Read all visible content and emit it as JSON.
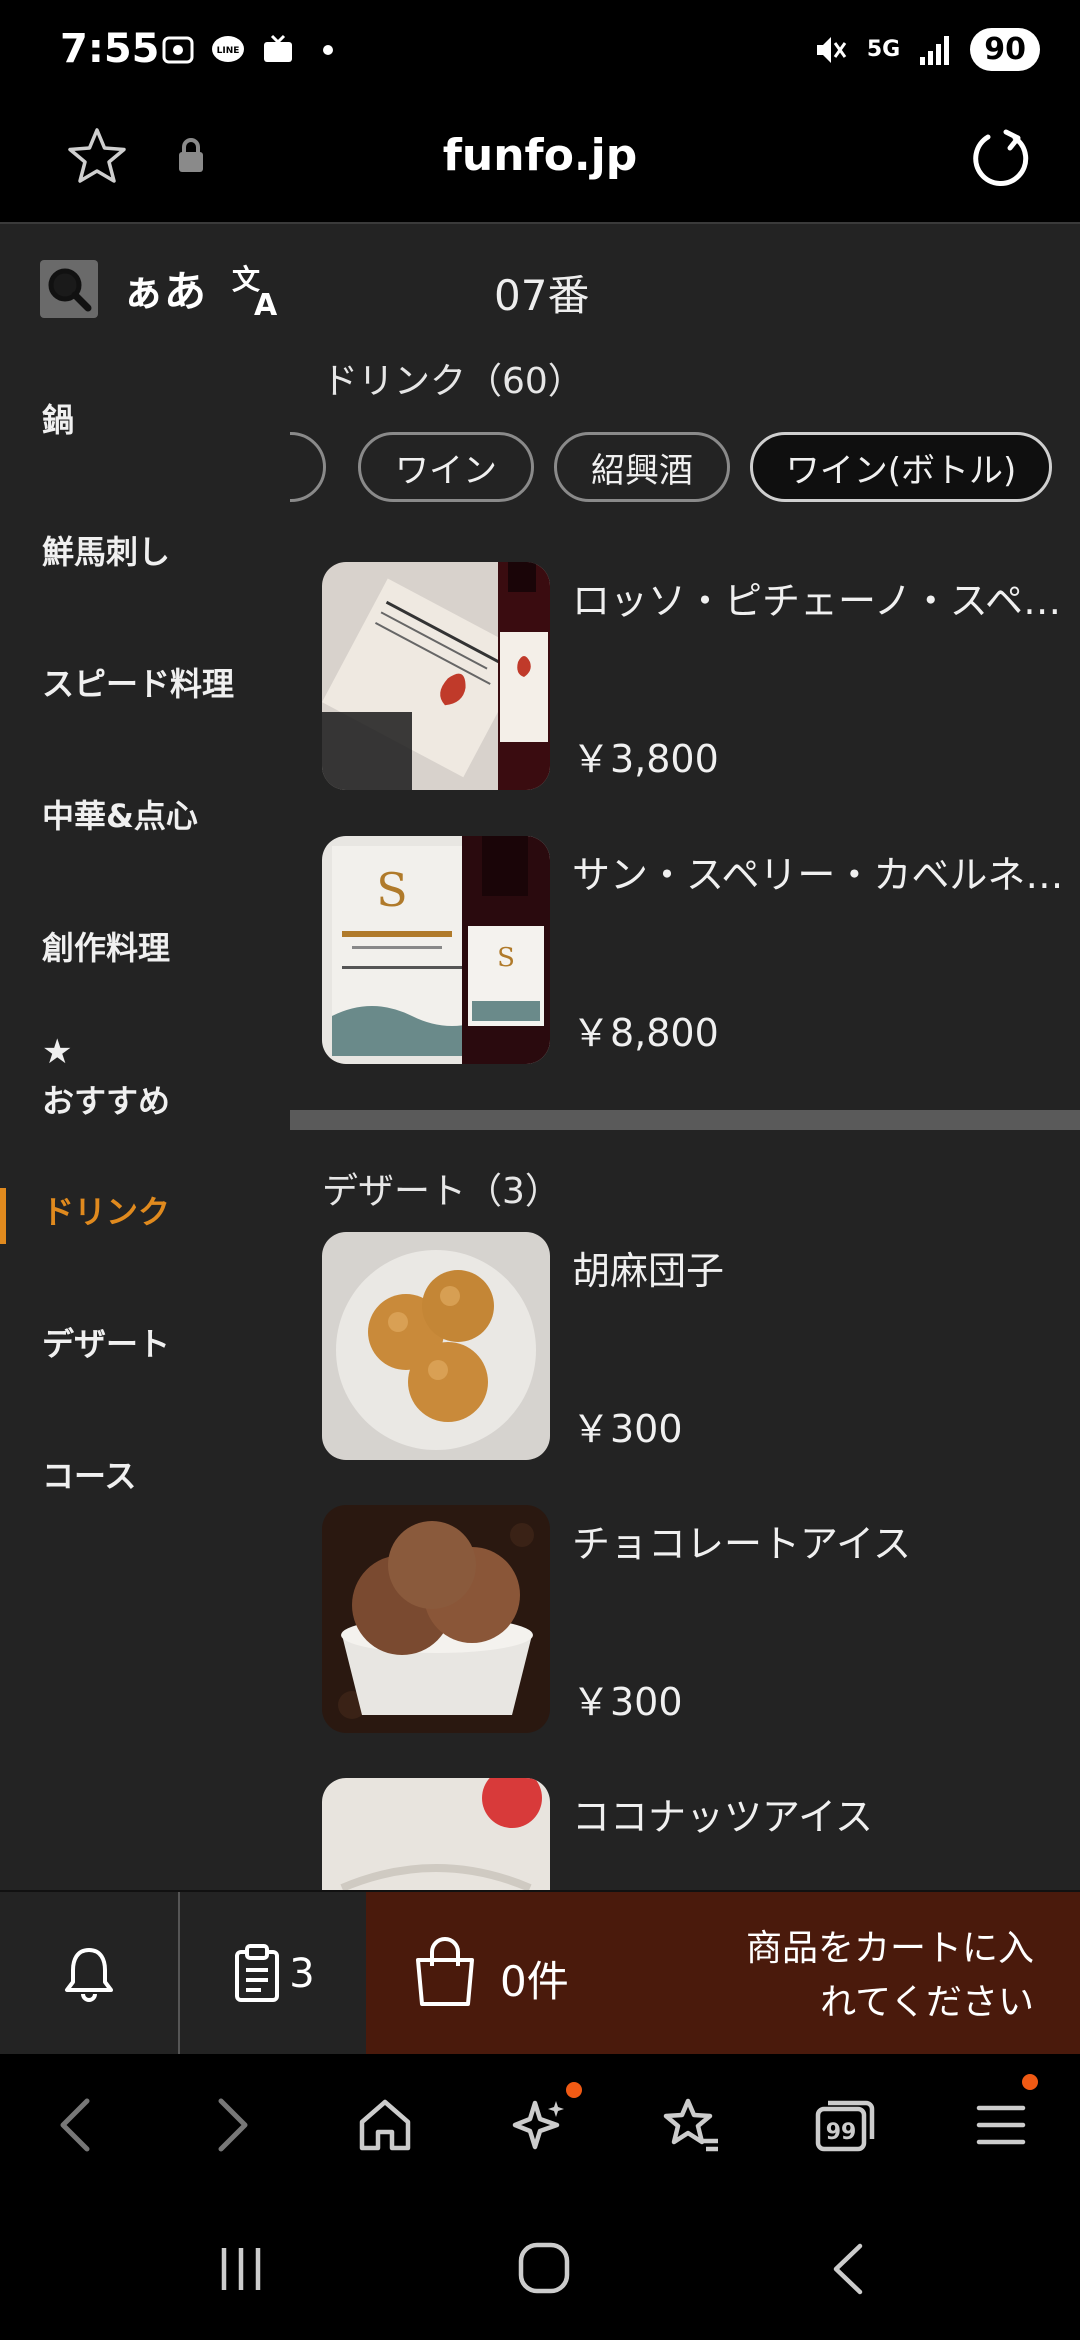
{
  "status": {
    "time": "7:55",
    "network": "5G",
    "battery": "90"
  },
  "browser": {
    "url": "funfo.jp"
  },
  "toolbar": {
    "font_toggle": "ぁあ",
    "table_number": "07番"
  },
  "sidebar": {
    "items": [
      {
        "label": "鍋"
      },
      {
        "label": "鮮馬刺し"
      },
      {
        "label": "スピード料理"
      },
      {
        "label": "中華&点心"
      },
      {
        "label": "創作料理"
      },
      {
        "label": "おすすめ",
        "icon": "star-icon"
      },
      {
        "label": "ドリンク",
        "active": true
      },
      {
        "label": "デザート"
      },
      {
        "label": "コース"
      }
    ]
  },
  "sections": {
    "drink": {
      "title": "ドリンク（60）",
      "chips": [
        "ワイン",
        "紹興酒",
        "ワイン(ボトル)"
      ],
      "active_chip": "ワイン(ボトル)",
      "items": [
        {
          "name": "ロッソ・ピチェーノ・スペリオーレ",
          "price": "￥3,800"
        },
        {
          "name": "サン・スペリー・カベルネ・ソーヴィニヨン",
          "price": "￥8,800"
        }
      ]
    },
    "dessert": {
      "title": "デザート（3）",
      "items": [
        {
          "name": "胡麻団子",
          "price": "￥300"
        },
        {
          "name": "チョコレートアイス",
          "price": "￥300"
        },
        {
          "name": "ココナッツアイス",
          "price": ""
        }
      ]
    }
  },
  "cart": {
    "orders_count": "3",
    "cart_count": "0件",
    "message": "商品をカートに入れてください",
    "accent_color": "#4a1a0c"
  },
  "colors": {
    "active": "#e08a1e",
    "background": "#232323",
    "notification_dot": "#f05a14"
  }
}
